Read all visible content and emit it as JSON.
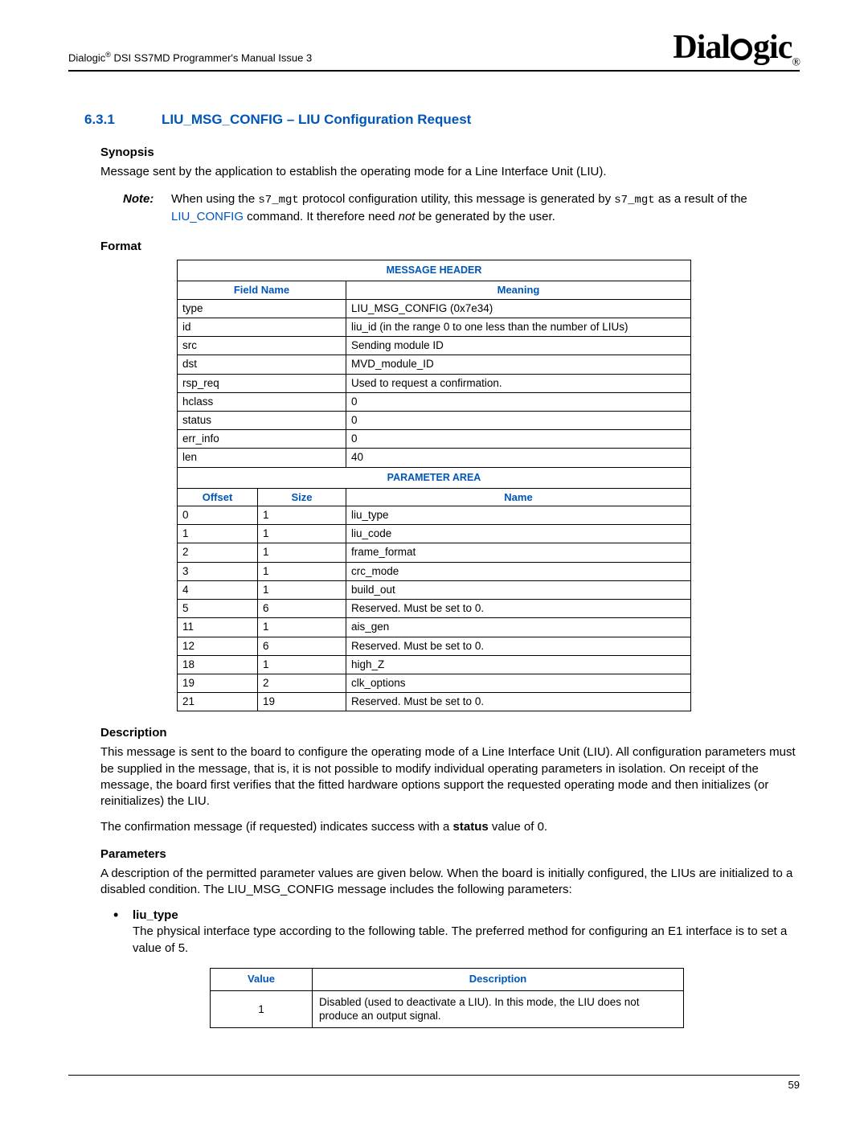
{
  "header": {
    "doc_title_prefix": "Dialogic",
    "doc_title_suffix": " DSI SS7MD Programmer's Manual  Issue 3",
    "brand": "Dialogic"
  },
  "section": {
    "number": "6.3.1",
    "title": "LIU_MSG_CONFIG – LIU Configuration Request"
  },
  "synopsis": {
    "heading": "Synopsis",
    "text": "Message sent by the application to establish the operating mode for a Line Interface Unit (LIU)."
  },
  "note": {
    "label": "Note:",
    "before_mono1": "When using the ",
    "mono1": "s7_mgt",
    "mid1": " protocol configuration utility, this message is generated by ",
    "mono2": "s7_mgt",
    "mid2": " as a result of the ",
    "link": "LIU_CONFIG",
    "mid3": " command. It therefore need ",
    "em": "not",
    "after": " be generated by the user."
  },
  "format_heading": "Format",
  "msg_table": {
    "band1": "MESSAGE HEADER",
    "col_field": "Field Name",
    "col_meaning": "Meaning",
    "rows1": [
      {
        "f": "type",
        "m": "LIU_MSG_CONFIG (0x7e34)"
      },
      {
        "f": "id",
        "m": "liu_id (in the range 0 to one less than the number of LIUs)"
      },
      {
        "f": "src",
        "m": "Sending module ID"
      },
      {
        "f": "dst",
        "m": "MVD_module_ID"
      },
      {
        "f": "rsp_req",
        "m": "Used to request a confirmation."
      },
      {
        "f": "hclass",
        "m": "0"
      },
      {
        "f": "status",
        "m": "0"
      },
      {
        "f": "err_info",
        "m": "0"
      },
      {
        "f": "len",
        "m": "40"
      }
    ],
    "band2": "PARAMETER AREA",
    "col_off": "Offset",
    "col_size": "Size",
    "col_name": "Name",
    "rows2": [
      {
        "o": "0",
        "s": "1",
        "n": "liu_type"
      },
      {
        "o": "1",
        "s": "1",
        "n": "liu_code"
      },
      {
        "o": "2",
        "s": "1",
        "n": "frame_format"
      },
      {
        "o": "3",
        "s": "1",
        "n": "crc_mode"
      },
      {
        "o": "4",
        "s": "1",
        "n": "build_out"
      },
      {
        "o": "5",
        "s": "6",
        "n": "Reserved. Must be set to 0."
      },
      {
        "o": "11",
        "s": "1",
        "n": "ais_gen"
      },
      {
        "o": "12",
        "s": "6",
        "n": "Reserved. Must be set to 0."
      },
      {
        "o": "18",
        "s": "1",
        "n": "high_Z"
      },
      {
        "o": "19",
        "s": "2",
        "n": "clk_options"
      },
      {
        "o": "21",
        "s": "19",
        "n": "Reserved. Must be set to 0."
      }
    ]
  },
  "description": {
    "heading": "Description",
    "p1": "This message is sent to the board to configure the operating mode of a Line Interface Unit (LIU). All configuration parameters must be supplied in the message, that is, it is not possible to modify individual operating parameters in isolation. On receipt of the message, the board first verifies that the fitted hardware options support the requested operating mode and then initializes (or reinitializes) the LIU.",
    "p2_a": "The confirmation message (if requested) indicates success with a ",
    "p2_b": "status",
    "p2_c": " value of 0."
  },
  "parameters": {
    "heading": "Parameters",
    "intro": "A description of the permitted parameter values are given below. When the board is initially configured, the LIUs are initialized to a disabled condition. The LIU_MSG_CONFIG message includes the following parameters:"
  },
  "param_liu_type": {
    "name": "liu_type",
    "desc": "The physical interface type according to the following table. The preferred method for configuring an E1 interface is to set a value of 5.",
    "col_value": "Value",
    "col_desc": "Description",
    "rows": [
      {
        "v": "1",
        "d": "Disabled (used to deactivate a LIU). In this mode, the LIU does not produce an output signal."
      }
    ]
  },
  "page_number": "59"
}
